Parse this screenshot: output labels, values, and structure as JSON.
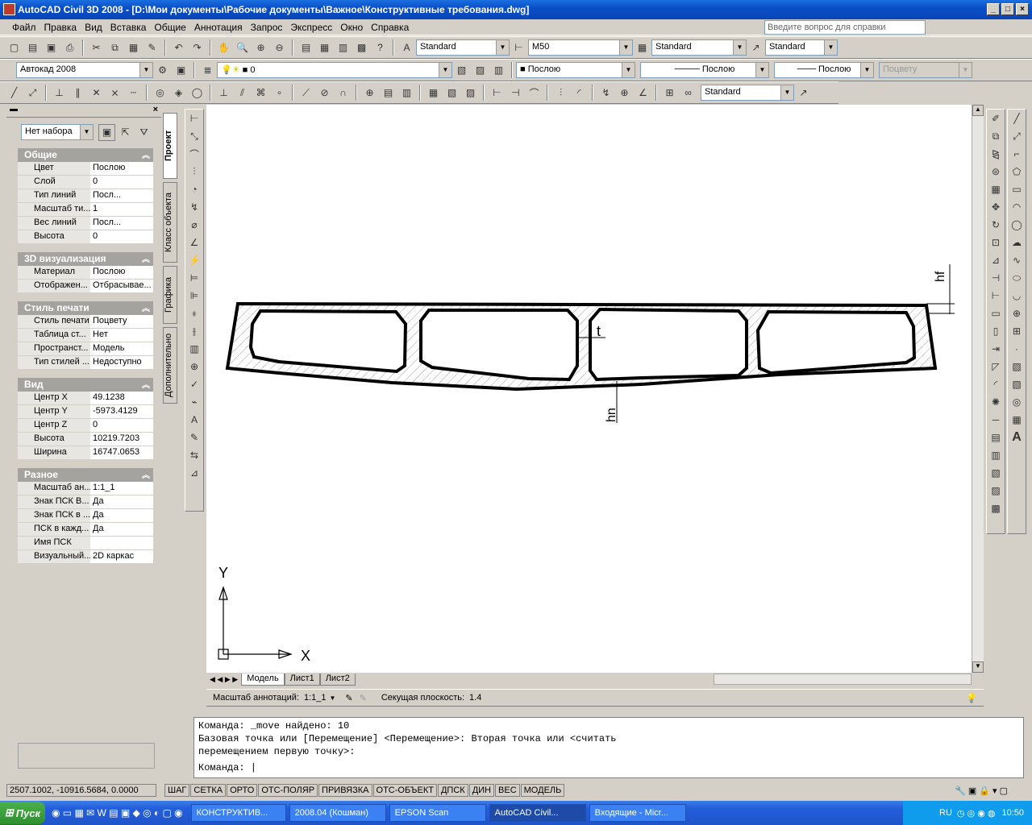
{
  "app": {
    "title": "AutoCAD Civil 3D 2008 - [D:\\Мои документы\\Рабочие документы\\Важное\\Конструктивные требования.dwg]"
  },
  "menu": [
    "Файл",
    "Правка",
    "Вид",
    "Вставка",
    "Общие",
    "Аннотация",
    "Запрос",
    "Экспресс",
    "Окно",
    "Справка"
  ],
  "help_placeholder": "Введите вопрос для справки",
  "toolbar1": {
    "textstyle": "Standard",
    "dimstyle": "M50",
    "tablestyle": "Standard",
    "mlstyle": "Standard"
  },
  "toolbar2": {
    "workspace": "Автокад 2008",
    "layer": "0",
    "color": "Послою",
    "linetype": "Послою",
    "lineweight": "Послою",
    "plotstyle": "Поцвету"
  },
  "toolbar3": {
    "dimstyle2": "Standard"
  },
  "palette": {
    "selection": "Нет набора",
    "tabs": [
      "Проект",
      "Класс объекта",
      "Графика",
      "Дополнительно"
    ],
    "groups": [
      {
        "title": "Общие",
        "rows": [
          [
            "Цвет",
            "Послою"
          ],
          [
            "Слой",
            "0"
          ],
          [
            "Тип линий",
            "Посл..."
          ],
          [
            "Масштаб ти...",
            "1"
          ],
          [
            "Вес линий",
            "Посл..."
          ],
          [
            "Высота",
            "0"
          ]
        ]
      },
      {
        "title": "3D визуализация",
        "rows": [
          [
            "Материал",
            "Послою"
          ],
          [
            "Отображен...",
            "Отбрасывае..."
          ]
        ]
      },
      {
        "title": "Стиль печати",
        "rows": [
          [
            "Стиль печати",
            "Поцвету"
          ],
          [
            "Таблица ст...",
            "Нет"
          ],
          [
            "Пространст...",
            "Модель"
          ],
          [
            "Тип стилей ...",
            "Недоступно"
          ]
        ]
      },
      {
        "title": "Вид",
        "rows": [
          [
            "Центр X",
            "49.1238"
          ],
          [
            "Центр Y",
            "-5973.4129"
          ],
          [
            "Центр Z",
            "0"
          ],
          [
            "Высота",
            "10219.7203"
          ],
          [
            "Ширина",
            "16747.0653"
          ]
        ]
      },
      {
        "title": "Разное",
        "rows": [
          [
            "Масштаб ан...",
            "1:1_1"
          ],
          [
            "Знак ПСК В...",
            "Да"
          ],
          [
            "Знак ПСК в ...",
            "Да"
          ],
          [
            "ПСК в кажд...",
            "Да"
          ],
          [
            "Имя ПСК",
            ""
          ],
          [
            "Визуальный...",
            "2D каркас"
          ]
        ]
      }
    ]
  },
  "drawing": {
    "label_hf": "hf",
    "label_t": "t",
    "label_hn": "hn",
    "axis_x": "X",
    "axis_y": "Y"
  },
  "layout_tabs": [
    "Модель",
    "Лист1",
    "Лист2"
  ],
  "annot": {
    "scale_label": "Масштаб аннотаций:",
    "scale_value": "1:1_1",
    "section_label": "Секущая плоскость:",
    "section_value": "1.4"
  },
  "command": {
    "line1": "Команда: _move найдено: 10",
    "line2": "Базовая точка или [Перемещение] <Перемещение>: Вторая точка или <считать",
    "line3": "перемещением первую точку>:",
    "prompt": "Команда:"
  },
  "status": {
    "coords": "2507.1002, -10916.5684, 0.0000",
    "buttons": [
      "ШАГ",
      "СЕТКА",
      "ОРТО",
      "ОТС-ПОЛЯР",
      "ПРИВЯЗКА",
      "ОТС-ОБЪЕКТ",
      "ДПСК",
      "ДИН",
      "ВЕС",
      "МОДЕЛЬ"
    ]
  },
  "taskbar": {
    "start": "Пуск",
    "tasks": [
      "КОНСТРУКТИВ...",
      "2008.04 (Кошман)",
      "EPSON Scan",
      "AutoCAD Civil...",
      "Входящие - Micr..."
    ],
    "lang": "RU",
    "time": "10:50"
  }
}
